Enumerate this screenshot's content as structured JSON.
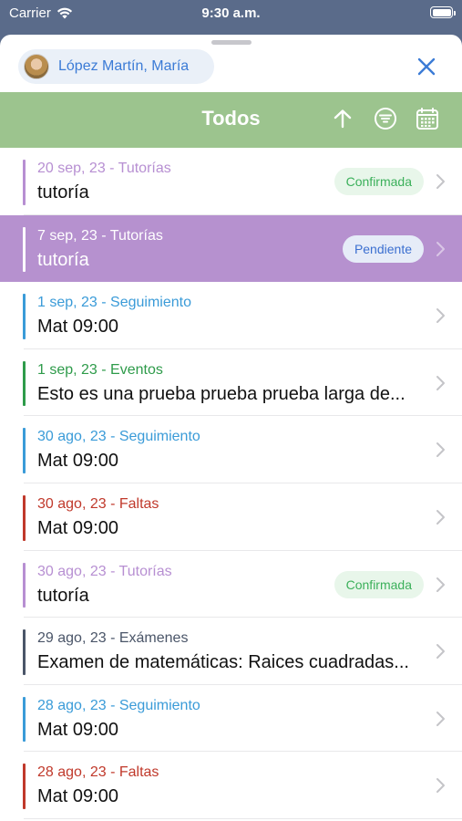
{
  "status_bar": {
    "carrier": "Carrier",
    "time": "9:30 a.m."
  },
  "header": {
    "user_name": "López Martín, María",
    "close_icon": "close-icon"
  },
  "toolbar": {
    "title": "Todos",
    "icons": [
      "sort-arrow-up-icon",
      "filter-icon",
      "calendar-icon"
    ],
    "bg_color": "#9cc48e"
  },
  "colors": {
    "tutorias": "#b78fd2",
    "seguimiento": "#3a9bd8",
    "eventos": "#2e9b4a",
    "faltas": "#c0392b",
    "examenes": "#4a5568",
    "selected_bg": "#b691cf"
  },
  "items": [
    {
      "meta": "20 sep, 23 - Tutorías",
      "title": "tutoría",
      "badge": "Confirmada",
      "badge_type": "confirmed",
      "color": "#b78fd2",
      "selected": false
    },
    {
      "meta": "7 sep, 23 - Tutorías",
      "title": "tutoría",
      "badge": "Pendiente",
      "badge_type": "pending",
      "color": "#b78fd2",
      "selected": true
    },
    {
      "meta": "1 sep, 23 - Seguimiento",
      "title": "Mat 09:00",
      "badge": "",
      "badge_type": "",
      "color": "#3a9bd8",
      "selected": false
    },
    {
      "meta": "1 sep, 23 - Eventos",
      "title": "Esto es una prueba prueba prueba larga de...",
      "badge": "",
      "badge_type": "",
      "color": "#2e9b4a",
      "selected": false
    },
    {
      "meta": "30 ago, 23 - Seguimiento",
      "title": "Mat 09:00",
      "badge": "",
      "badge_type": "",
      "color": "#3a9bd8",
      "selected": false
    },
    {
      "meta": "30 ago, 23 - Faltas",
      "title": "Mat 09:00",
      "badge": "",
      "badge_type": "",
      "color": "#c0392b",
      "selected": false
    },
    {
      "meta": "30 ago, 23 - Tutorías",
      "title": "tutoría",
      "badge": "Confirmada",
      "badge_type": "confirmed",
      "color": "#b78fd2",
      "selected": false
    },
    {
      "meta": "29 ago, 23 - Exámenes",
      "title": "Examen de matemáticas: Raices cuadradas...",
      "badge": "",
      "badge_type": "",
      "color": "#4a5568",
      "selected": false
    },
    {
      "meta": "28 ago, 23 - Seguimiento",
      "title": "Mat 09:00",
      "badge": "",
      "badge_type": "",
      "color": "#3a9bd8",
      "selected": false
    },
    {
      "meta": "28 ago, 23 - Faltas",
      "title": "Mat 09:00",
      "badge": "",
      "badge_type": "",
      "color": "#c0392b",
      "selected": false
    }
  ]
}
